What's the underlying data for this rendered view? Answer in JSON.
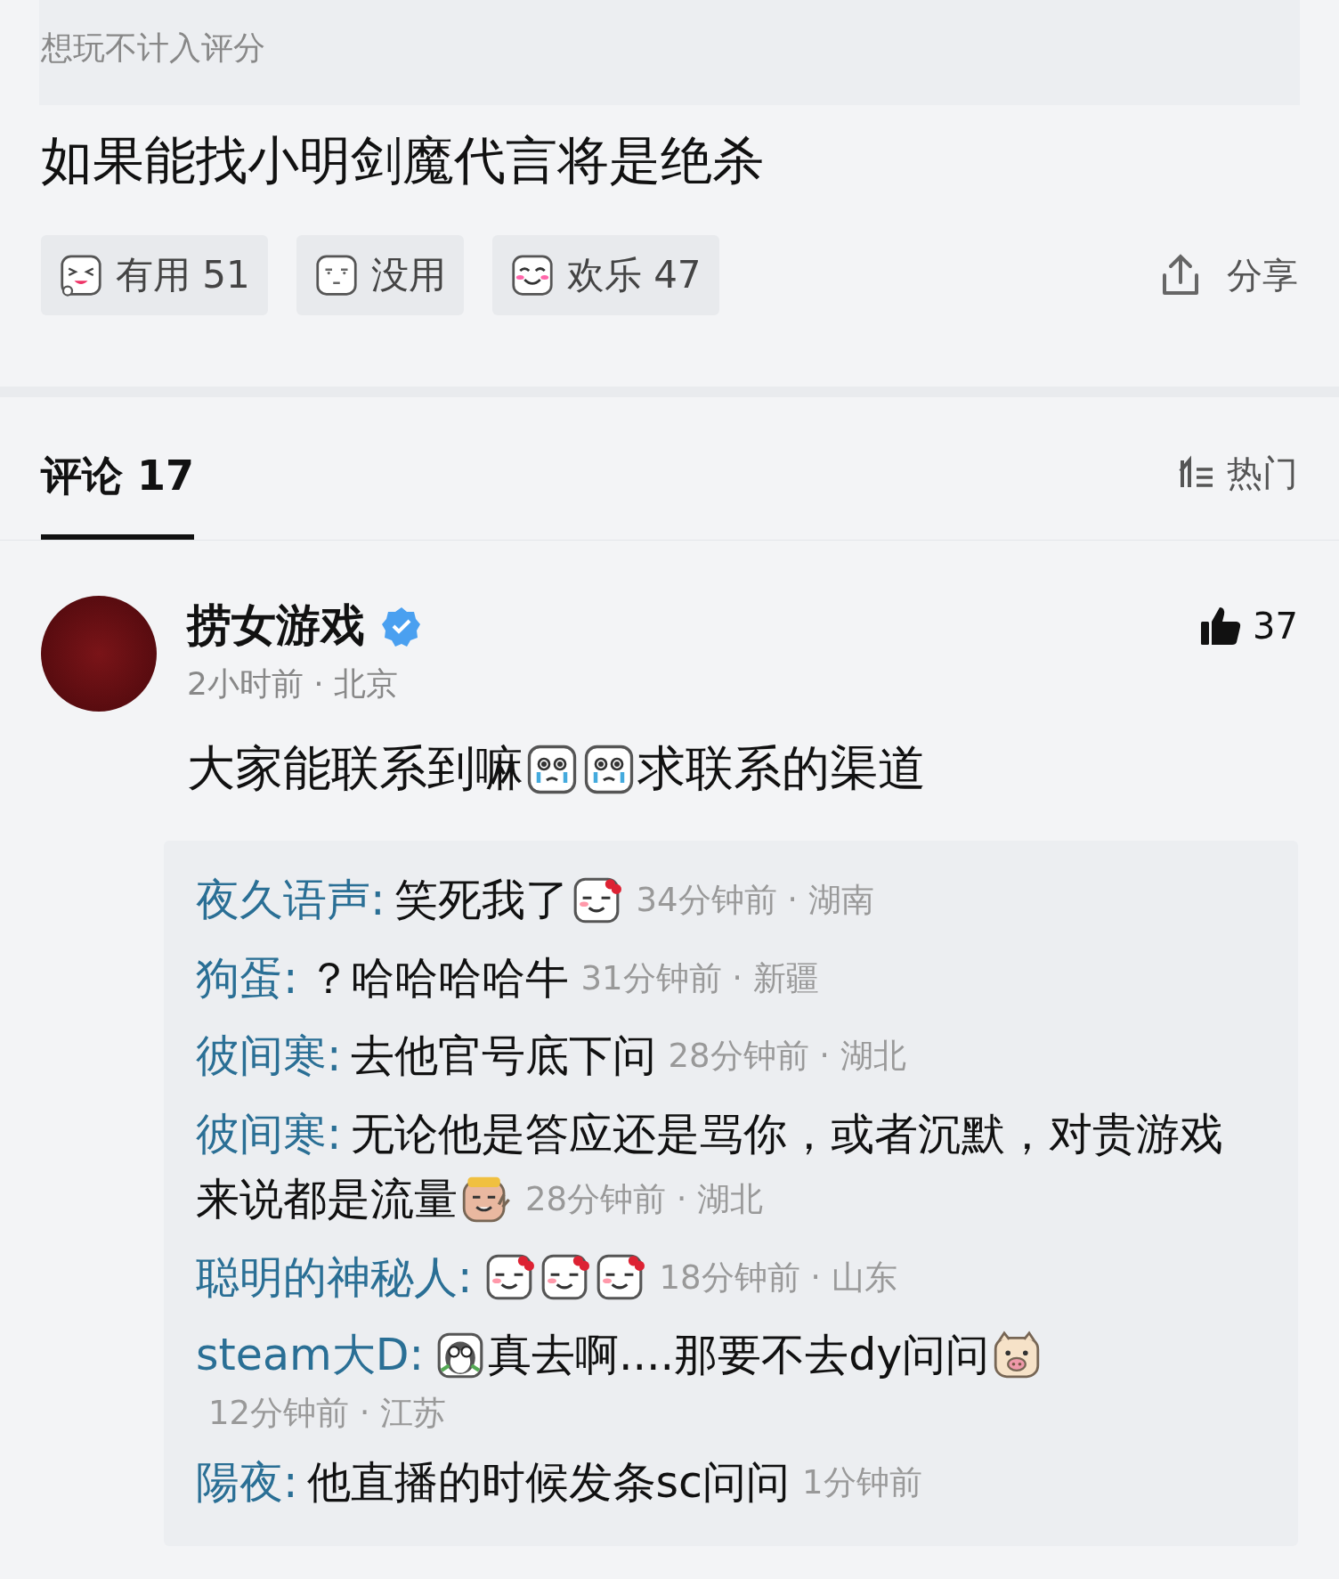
{
  "note": "想玩不计入评分",
  "review_text": "如果能找小明剑魔代言将是绝杀",
  "reactions": [
    {
      "kind": "laugh",
      "label": "有用 51"
    },
    {
      "kind": "blank",
      "label": "没用"
    },
    {
      "kind": "smile",
      "label": "欢乐 47"
    }
  ],
  "share": {
    "label": "分享"
  },
  "comments_tab": {
    "label": "评论 17",
    "selected": true
  },
  "sort": {
    "label": "热门"
  },
  "comment": {
    "author": "捞女游戏",
    "verified": true,
    "meta": "2小时前 · 北京",
    "likes": "37",
    "body": [
      {
        "kind": "text",
        "text": "大家能联系到嘛"
      },
      {
        "kind": "cry"
      },
      {
        "kind": "cry"
      },
      {
        "kind": "text",
        "text": "求联系的渠道"
      }
    ]
  },
  "replies": [
    {
      "author": "夜久语声:",
      "parts": [
        {
          "kind": "text",
          "text": "笑死我了"
        },
        {
          "kind": "blush"
        }
      ],
      "meta": "34分钟前 · 湖南"
    },
    {
      "author": "狗蛋:",
      "parts": [
        {
          "kind": "text",
          "text": "？哈哈哈哈牛"
        }
      ],
      "meta": "31分钟前 · 新疆"
    },
    {
      "author": "彼间寒:",
      "parts": [
        {
          "kind": "text",
          "text": "去他官号底下问"
        }
      ],
      "meta": "28分钟前 · 湖北"
    },
    {
      "author": "彼间寒:",
      "parts": [
        {
          "kind": "text",
          "text": "无论他是答应还是骂你，或者沉默，对贵游戏"
        },
        {
          "kind": "text",
          "text": "来说都是流量"
        },
        {
          "kind": "grin"
        }
      ],
      "meta": "28分钟前 · 湖北"
    },
    {
      "author": "聪明的神秘人:",
      "parts": [
        {
          "kind": "blush"
        },
        {
          "kind": "blush"
        },
        {
          "kind": "blush"
        }
      ],
      "meta": "18分钟前 · 山东"
    },
    {
      "author": "steam大D:",
      "parts": [
        {
          "kind": "penguin"
        },
        {
          "kind": "text",
          "text": "真去啊....那要不去dy问问"
        },
        {
          "kind": "pig"
        }
      ],
      "meta": "12分钟前 · 江苏"
    },
    {
      "author": "陽夜:",
      "parts": [
        {
          "kind": "text",
          "text": "他直播的时候发条sc问问"
        }
      ],
      "meta": "1分钟前"
    }
  ]
}
